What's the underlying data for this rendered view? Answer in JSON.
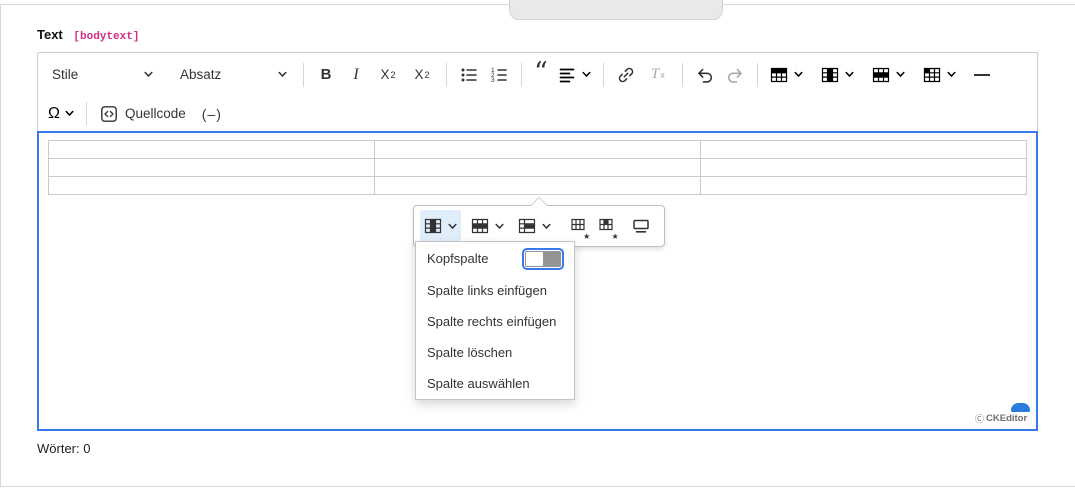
{
  "field": {
    "label": "Text",
    "tag": "[bodytext]"
  },
  "toolbar": {
    "styles": "Stile",
    "paragraph": "Absatz",
    "bold": "B",
    "italic": "I",
    "sub_base": "X",
    "sub_small": "2",
    "sup_base": "X",
    "sup_small": "2",
    "remove_base": "T",
    "remove_small": "x",
    "special_char": "Ω",
    "source": "Quellcode",
    "soft_hyphen": "(–)"
  },
  "icons": {
    "quote": "“",
    "star": "★",
    "copyright": "Ⓒ"
  },
  "balloon": {
    "buttons": [
      "table-column",
      "table-row",
      "merge-cells",
      "table-properties",
      "cell-properties",
      "toggle-caption"
    ]
  },
  "column_menu": {
    "items": [
      {
        "label": "Kopfspalte",
        "control": "switch",
        "state": "off"
      },
      {
        "label": "Spalte links einfügen"
      },
      {
        "label": "Spalte rechts einfügen"
      },
      {
        "label": "Spalte löschen"
      },
      {
        "label": "Spalte auswählen"
      }
    ]
  },
  "editor": {
    "table": {
      "rows": 3,
      "columns": 3
    }
  },
  "status": {
    "word_count": "Wörter: 0"
  },
  "branding": {
    "name": "CKEditor"
  },
  "colors": {
    "focus_border": "#3779eb",
    "active_button_bg": "#e0edfb",
    "tag_color": "#d22c87"
  }
}
